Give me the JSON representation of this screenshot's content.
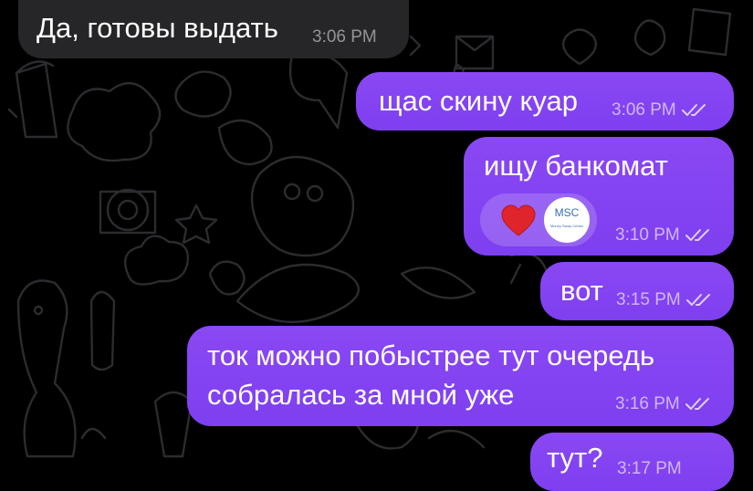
{
  "messages": [
    {
      "text": "Да, готовы выдать",
      "time": "3:06 PM"
    },
    {
      "text": "щас скину куар",
      "time": "3:06 PM"
    },
    {
      "text": "ищу банкомат",
      "time": "3:10 PM",
      "reaction_avatar": {
        "initials": "MSC",
        "caption": "Money Swap Center"
      }
    },
    {
      "text": "вот",
      "time": "3:15 PM"
    },
    {
      "lines": [
        "ток можно побыстрее тут очередь",
        "собралась за мной уже"
      ],
      "time": "3:16 PM"
    },
    {
      "text": "тут?",
      "time": "3:17 PM"
    }
  ],
  "icons": {
    "read_receipt": "double-check-icon",
    "reaction": "heart-icon"
  },
  "colors": {
    "outgoing_bubble": "#8a48f3",
    "incoming_bubble": "#262628",
    "background": "#000000",
    "heart": "#e0242b"
  }
}
